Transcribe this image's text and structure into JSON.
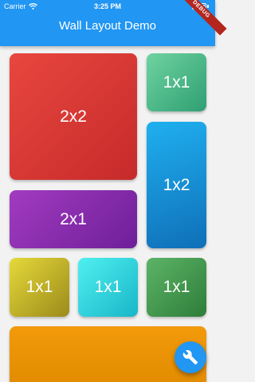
{
  "status_bar": {
    "carrier": "Carrier",
    "time": "3:25 PM"
  },
  "app_bar": {
    "title": "Wall Layout Demo",
    "debug_banner": "DEBUG",
    "color": "#2196f3"
  },
  "tiles": [
    {
      "label": "2x2",
      "color": "#d93a35"
    },
    {
      "label": "1x1",
      "color": "#4fbf8c"
    },
    {
      "label": "1x2",
      "color": "#1690d6"
    },
    {
      "label": "2x1",
      "color": "#8a2cae"
    },
    {
      "label": "1x1",
      "color": "#c8bb2c"
    },
    {
      "label": "1x1",
      "color": "#30d4dc"
    },
    {
      "label": "1x1",
      "color": "#439a4f"
    },
    {
      "label": "",
      "color": "#ee9405"
    }
  ],
  "fab": {
    "icon": "wrench-icon",
    "color": "#2196f3"
  }
}
